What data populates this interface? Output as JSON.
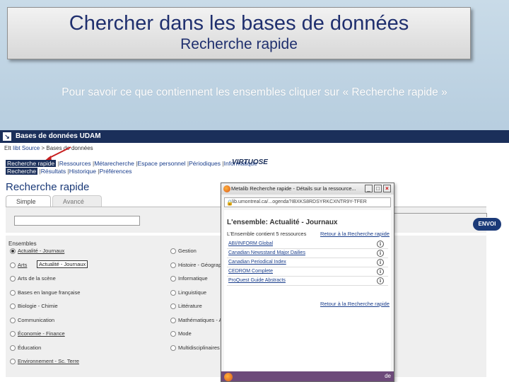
{
  "slide": {
    "title": "Chercher dans les bases de données",
    "subtitle": "Recherche rapide",
    "instruction": "Pour savoir ce que contiennent les ensembles cliquer sur « Recherche rapide »"
  },
  "site": {
    "header": "Bases de données UDAM",
    "arrow_glyph": "↘",
    "breadcrumb_prefix": "EIt",
    "breadcrumb_link": "Iibt Source",
    "breadcrumb_rest": "> Bases de données",
    "nav_row1": {
      "active": "Recherche rapide",
      "items": [
        "Ressources",
        "Métarecherche",
        "Espace personnel",
        "Périodiques",
        "Informatique"
      ]
    },
    "nav_row2": {
      "active": "Recherche",
      "items": [
        "Résultats",
        "Historique",
        "Préférences"
      ]
    },
    "logo": "VIRTUOSE",
    "page_heading": "Recherche rapide",
    "tabs": [
      "Simple",
      "Avancé"
    ],
    "search_value": "",
    "send_button": "ENVOI",
    "ensembles_label": "Ensembles",
    "tooltip": "Actualité - Journaux",
    "options_col1": [
      {
        "label": "Actualité - Journaux",
        "selected": true,
        "underline": true
      },
      {
        "label": "Arts",
        "selected": false,
        "underline": true
      },
      {
        "label": "Arts de la scène",
        "selected": false,
        "underline": false
      },
      {
        "label": "Bases en langue française",
        "selected": false,
        "underline": false
      },
      {
        "label": "Biologie - Chimie",
        "selected": false,
        "underline": false
      },
      {
        "label": "Communication",
        "selected": false,
        "underline": false
      },
      {
        "label": "Économie - Finance",
        "selected": false,
        "underline": true
      },
      {
        "label": "Éducation",
        "selected": false,
        "underline": false
      },
      {
        "label": "Environnement - Sc. Terre",
        "selected": false,
        "underline": true
      }
    ],
    "options_col2": [
      {
        "label": "Gestion",
        "selected": false
      },
      {
        "label": "Histoire - Géograph",
        "selected": false
      },
      {
        "label": "Informatique",
        "selected": false
      },
      {
        "label": "Linguistique",
        "selected": false
      },
      {
        "label": "Littérature",
        "selected": false
      },
      {
        "label": "Mathématiques - A",
        "selected": false
      },
      {
        "label": "Mode",
        "selected": false
      },
      {
        "label": "Multidisciplinaires",
        "selected": false
      }
    ]
  },
  "popup": {
    "window_title": "Metalib Recherche rapide - Détails sur la ressource...",
    "url": "lib.umontreal.ca/...ogenda?IBXKS8RDSYRKCXNTR9Y-TFER",
    "heading": "L'ensemble: Actualité - Journaux",
    "subheading": "L'Ensemble contient 5 ressources",
    "return_link_top": "Retour à la Recherche rapide",
    "return_link_bottom": "Retour à la Recherche rapide",
    "resources": [
      "ABI/INFORM Global",
      "Canadian Newsstand Major Dailies",
      "Canadian Periodical Index",
      "CEDROM Complete",
      "ProQuest Guide Abstracts"
    ],
    "info_glyph": "i",
    "min_glyph": "_",
    "max_glyph": "□",
    "close_glyph": "×",
    "lock_glyph": "🔒",
    "taskbar_text": "de"
  }
}
